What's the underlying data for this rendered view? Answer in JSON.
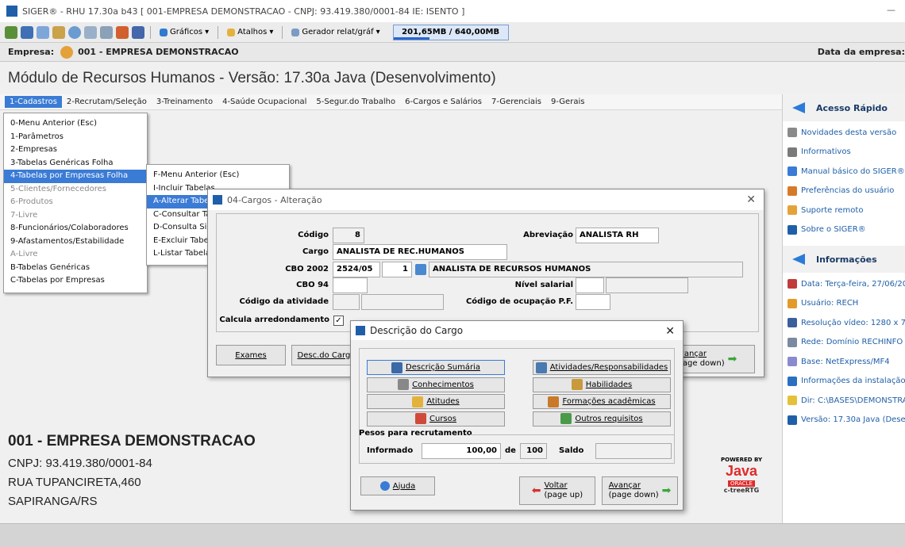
{
  "window": {
    "title": "SIGER® - RHU 17.30a b43 [ 001-EMPRESA DEMONSTRACAO - CNPJ: 93.419.380/0001-84 IE: ISENTO ]",
    "minimize": "—"
  },
  "toolbar": {
    "graficos": "Gráficos",
    "atalhos": "Atalhos",
    "gerador": "Gerador relat/gráf",
    "memory": "201,65MB / 640,00MB",
    "memory_used_fraction": 0.315
  },
  "empresa_bar": {
    "label": "Empresa:",
    "value": "001 - EMPRESA DEMONSTRACAO",
    "right": "Data da empresa:"
  },
  "module_title": "Módulo de Recursos Humanos - Versão: 17.30a Java (Desenvolvimento)",
  "menubar": [
    "1-Cadastros",
    "2-Recrutam/Seleção",
    "3-Treinamento",
    "4-Saúde Ocupacional",
    "5-Segur.do Trabalho",
    "6-Cargos e Salários",
    "7-Gerenciais",
    "9-Gerais"
  ],
  "menu_cadastros": [
    "0-Menu Anterior (Esc)",
    "1-Parâmetros",
    "2-Empresas",
    "3-Tabelas Genéricas Folha",
    "4-Tabelas por Empresas Folha",
    "5-Clientes/Fornecedores",
    "6-Produtos",
    "7-Livre",
    "8-Funcionários/Colaboradores",
    "9-Afastamentos/Estabilidade",
    "A-Livre",
    "B-Tabelas Genéricas",
    "C-Tabelas por Empresas"
  ],
  "menu_tabelas": [
    "F-Menu Anterior (Esc)",
    "I-Incluir Tabelas",
    "A-Alterar Tabe",
    "C-Consultar Ta",
    "D-Consulta Sim",
    "E-Excluir Tabel",
    "L-Listar Tabela"
  ],
  "company": {
    "name": "001 - EMPRESA DEMONSTRACAO",
    "cnpj": "CNPJ: 93.419.380/0001-84",
    "address": "RUA TUPANCIRETA,460",
    "city": "SAPIRANGA/RS"
  },
  "acesso_rapido": {
    "title": "Acesso Rápido",
    "items": [
      "Novidades desta versão",
      "Informativos",
      "Manual básico do SIGER®",
      "Preferências do usuário",
      "Suporte remoto",
      "Sobre o SIGER®"
    ]
  },
  "informacoes": {
    "title": "Informações",
    "items": [
      "Data: Terça-feira, 27/06/20",
      "Usuário: RECH",
      "Resolução vídeo: 1280 x 72",
      "Rede: Domínio RECHINFO (",
      "Base: NetExpress/MF4",
      "Informações da instalação/a",
      "Dir:  C:\\BASES\\DEMONSTRA",
      "Versão: 17.30a Java (Desen"
    ]
  },
  "cargos_dialog": {
    "title": "04-Cargos - Alteração",
    "codigo_label": "Código",
    "codigo": "8",
    "abreviacao_label": "Abreviação",
    "abreviacao": "ANALISTA RH",
    "cargo_label": "Cargo",
    "cargo": "ANALISTA DE REC.HUMANOS",
    "cbo2002_label": "CBO 2002",
    "cbo2002": "2524/05",
    "cbo2002_seq": "1",
    "cbo2002_desc": "ANALISTA DE RECURSOS HUMANOS",
    "cbo94_label": "CBO 94",
    "nivel_label": "Nível salarial",
    "codigo_atividade_label": "Código da atividade",
    "codigo_ocupacao_label": "Código de ocupação P.F.",
    "calcula_label": "Calcula arredondamento",
    "calcula_check": "✓",
    "btn_exames": "Exames",
    "btn_desc": "Desc.do Cargo",
    "btn_avancar": "Avançar",
    "btn_avancar_sub": "(page down)"
  },
  "descricao_dialog": {
    "title": "Descrição do Cargo",
    "buttons_left": [
      "Descrição Sumária",
      "Conhecimentos",
      "Atitudes",
      "Cursos"
    ],
    "buttons_right": [
      "Atividades/Responsabilidades",
      "Habilidades",
      "Formações acadêmicas",
      "Outros requisitos"
    ],
    "pesos_title": "Pesos para recrutamento",
    "informado_label": "Informado",
    "informado": "100,00",
    "de_label": "de",
    "de_value": "100",
    "saldo_label": "Saldo",
    "ajuda": "Ajuda",
    "voltar": "Voltar",
    "voltar_sub": "(page up)",
    "avancar": "Avançar",
    "avancar_sub": "(page down)"
  },
  "java_logo": {
    "powered": "POWERED BY",
    "java": "Java",
    "oracle": "ORACLE",
    "ctree": "c-treeRTG"
  },
  "colors": {
    "accent": "#3a7bd5",
    "link": "#1f5fa8"
  }
}
